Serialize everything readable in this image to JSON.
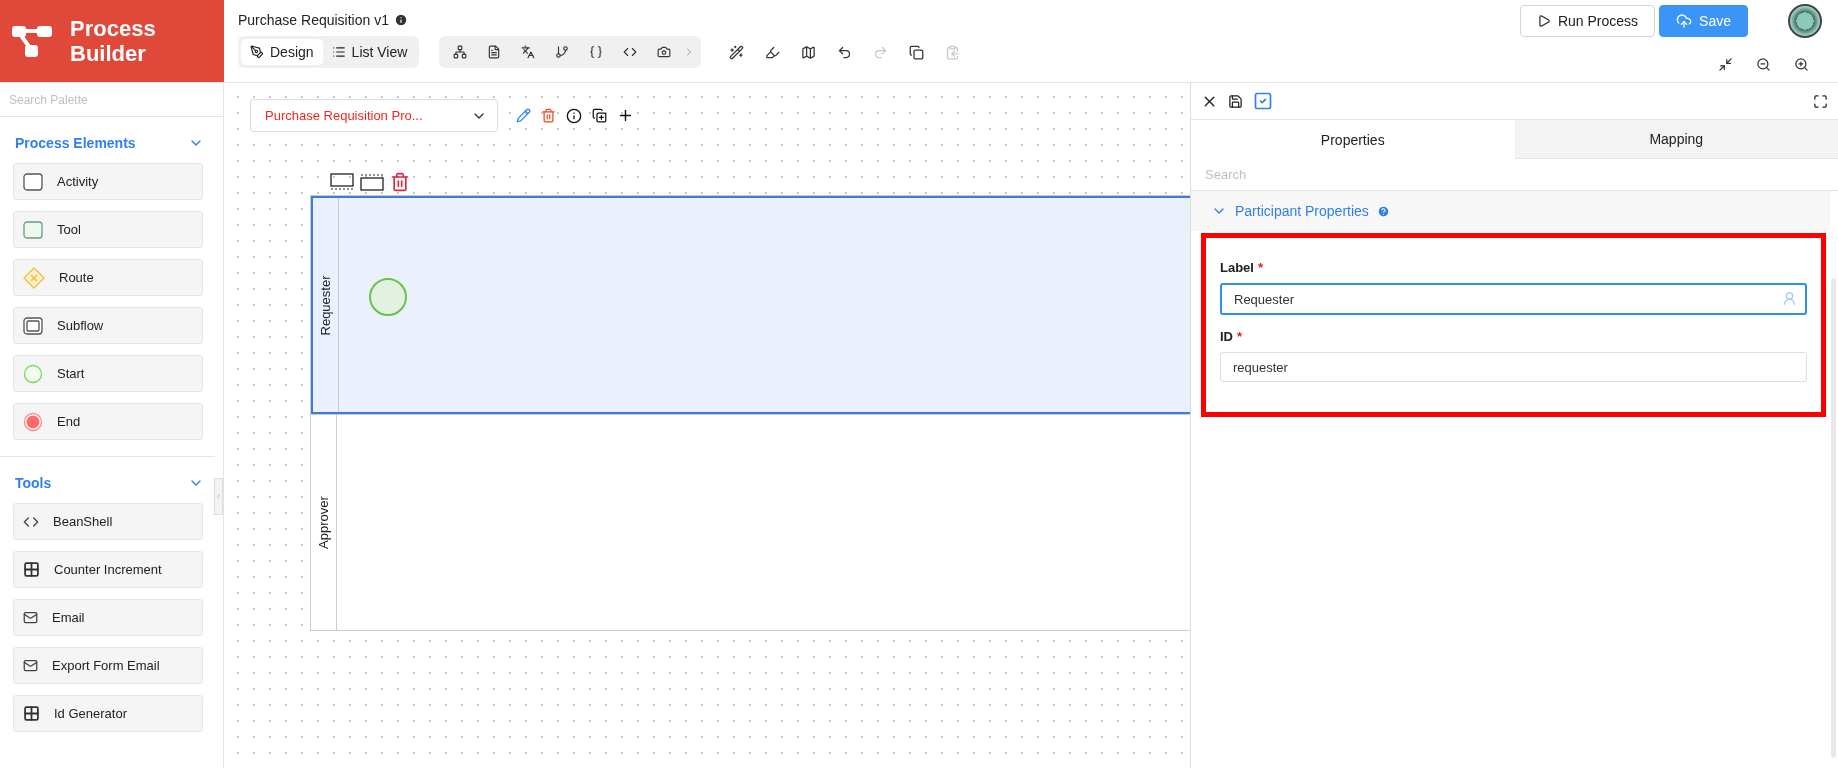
{
  "app": {
    "title_line1": "Process",
    "title_line2": "Builder"
  },
  "document": {
    "title": "Purchase Requisition v1"
  },
  "view_tabs": [
    {
      "label": "Design",
      "selected": true
    },
    {
      "label": "List View",
      "selected": false
    }
  ],
  "header_buttons": [
    {
      "label": "Run Process",
      "kind": "outline"
    },
    {
      "label": "Save",
      "kind": "primary"
    }
  ],
  "palette": {
    "search_placeholder": "Search Palette",
    "sections": [
      {
        "title": "Process Elements",
        "expanded": true,
        "items": [
          {
            "label": "Activity",
            "kind": "activity"
          },
          {
            "label": "Tool",
            "kind": "tool"
          },
          {
            "label": "Route",
            "kind": "route"
          },
          {
            "label": "Subflow",
            "kind": "subflow"
          },
          {
            "label": "Start",
            "kind": "start"
          },
          {
            "label": "End",
            "kind": "end"
          }
        ]
      },
      {
        "title": "Tools",
        "expanded": true,
        "items": [
          {
            "label": "BeanShell",
            "kind": "code"
          },
          {
            "label": "Counter Increment",
            "kind": "grid"
          },
          {
            "label": "Email",
            "kind": "mail"
          },
          {
            "label": "Export Form Email",
            "kind": "mail"
          },
          {
            "label": "Id Generator",
            "kind": "grid"
          }
        ]
      }
    ]
  },
  "canvas": {
    "process_select": "Purchase Requisition Pro...",
    "lanes": [
      {
        "label": "Requester",
        "selected": true,
        "has_start": true
      },
      {
        "label": "Approver",
        "selected": false,
        "has_start": false
      }
    ]
  },
  "panel": {
    "tabs": [
      {
        "label": "Properties",
        "selected": true
      },
      {
        "label": "Mapping",
        "selected": false
      }
    ],
    "search_placeholder": "Search",
    "section": {
      "title": "Participant Properties",
      "expanded": true
    },
    "fields": [
      {
        "label": "Label",
        "required_mark": "*",
        "value": "Requester",
        "focused": true
      },
      {
        "label": "ID",
        "required_mark": "*",
        "value": "requester",
        "focused": false
      }
    ]
  }
}
